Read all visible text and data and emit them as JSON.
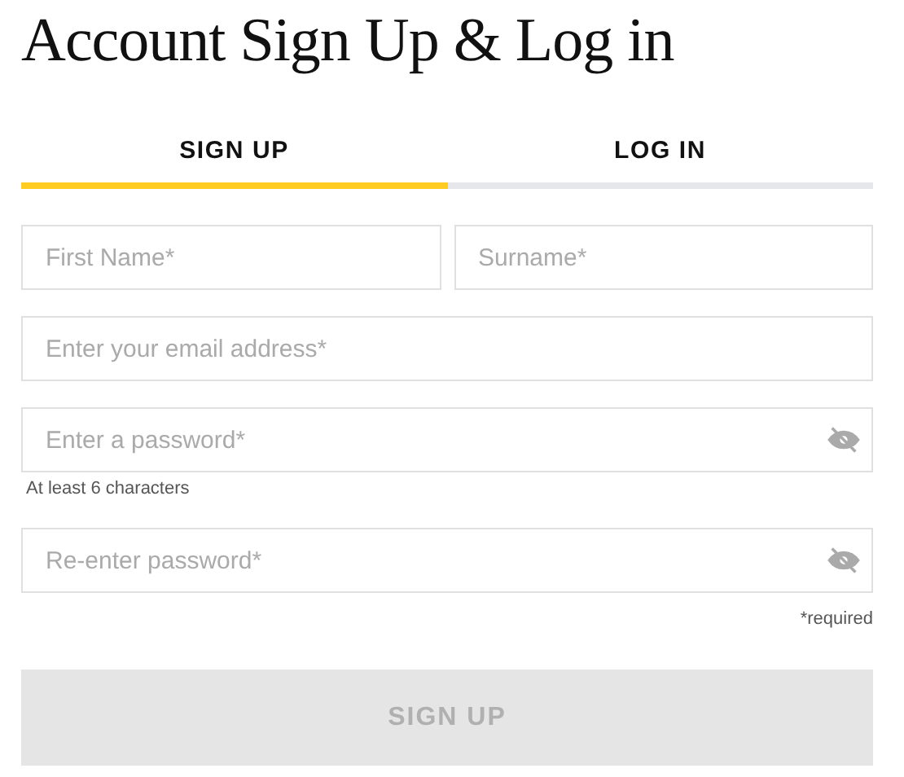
{
  "title": "Account Sign Up & Log in",
  "tabs": [
    {
      "label": "SIGN UP",
      "selected": true
    },
    {
      "label": "LOG IN",
      "selected": false
    }
  ],
  "form": {
    "name_row": [
      {
        "placeholder": "First Name*"
      },
      {
        "placeholder": "Surname*"
      }
    ],
    "fields": [
      {
        "kind": "text",
        "placeholder": "Enter your email address*"
      },
      {
        "kind": "password",
        "placeholder": "Enter a password*",
        "hint": "At least 6 characters"
      },
      {
        "kind": "password",
        "placeholder": "Re-enter password*"
      }
    ],
    "required_note": "*required",
    "submit": {
      "label": "SIGN UP",
      "disabled": true
    }
  }
}
